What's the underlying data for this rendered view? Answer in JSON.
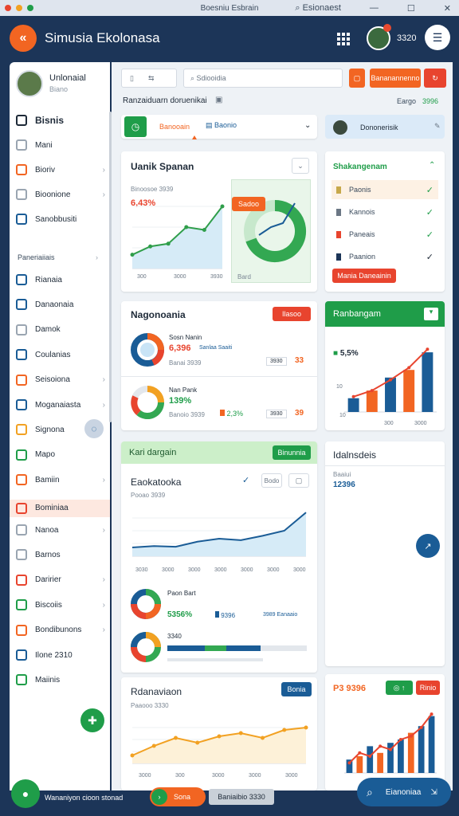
{
  "os": {
    "title": "Boesniu Esbrain",
    "controls": [
      "Esionaest",
      "—",
      "☐",
      "✕"
    ]
  },
  "app": {
    "title": "Simusia Ekolonasa",
    "logo": "«",
    "header_count": "3320"
  },
  "profile": {
    "name": "Unlonaial",
    "sub": "Biano"
  },
  "sidebar": {
    "top_items": [
      {
        "label": "Bisnis",
        "icon": "sliders-icon"
      },
      {
        "label": "Mani",
        "icon": "clock-icon"
      },
      {
        "label": "Bioriv",
        "icon": "folder-icon"
      },
      {
        "label": "Bioonione",
        "icon": "stack-icon"
      },
      {
        "label": "Sanobbusiti",
        "icon": "refresh-icon"
      }
    ],
    "section_label": "Paneriaiiais",
    "items": [
      {
        "label": "Rianaia",
        "color": "#1a5c96"
      },
      {
        "label": "Danaonaia",
        "color": "#1a5c96"
      },
      {
        "label": "Damok",
        "color": "#9aa5b1"
      },
      {
        "label": "Coulanias",
        "color": "#1a5c96"
      },
      {
        "label": "Seisoiona",
        "color": "#f26522"
      },
      {
        "label": "Moganaiasta",
        "color": "#1a5c96"
      },
      {
        "label": "Signona",
        "color": "#f2a122"
      },
      {
        "label": "Mapo",
        "color": "#1f9d49"
      },
      {
        "label": "Bamiin",
        "color": "#f26522"
      },
      {
        "label": "Bominiaa",
        "color": "#e8442e"
      },
      {
        "label": "Nanoa",
        "color": "#9aa5b1"
      },
      {
        "label": "Barnos",
        "color": "#9aa5b1"
      },
      {
        "label": "Daririer",
        "color": "#e8442e"
      },
      {
        "label": "Biscoiis",
        "color": "#1f9d49"
      },
      {
        "label": "Bondibunons",
        "color": "#f26522"
      },
      {
        "label": "Ilone 2310",
        "color": "#1a5c96"
      },
      {
        "label": "Maiinis",
        "color": "#1f9d49"
      }
    ]
  },
  "toolbar": {
    "search_placeholder": "Sdiooidia",
    "btn1": "▢",
    "btn2": "Bananannenno",
    "btn3": "↻",
    "breadcrumb": "Ranzaiduarn doruenikai",
    "right1": "Eargo",
    "right2": "3996"
  },
  "tabs": {
    "t1": "Banooain",
    "t2": "Baonio",
    "profile_tab": "Dononerisik"
  },
  "card1": {
    "title": "Uanik Spanan",
    "subtitle": "Binoosoe 3939",
    "stat": "6,43%",
    "badge": "Sadoo",
    "ticks": [
      "300",
      "3000",
      "3930"
    ],
    "gauge_label": "Bard"
  },
  "card2": {
    "title": "Shakangenam",
    "rows": [
      {
        "label": "Paonis",
        "color": "#c7a84a"
      },
      {
        "label": "Kannois",
        "color": "#6b7785"
      },
      {
        "label": "Paneais",
        "color": "#e8442e"
      },
      {
        "label": "Paanion",
        "color": "#1c3558"
      }
    ],
    "button": "Mania Daneainin"
  },
  "card3": {
    "title": "Nagonoania",
    "button": "Ilasoo",
    "row1": {
      "label": "Sosn Nanin",
      "stat": "6,396",
      "extra": "Sanlaa Saaiti",
      "sub": "Banai 3939",
      "right": "3930",
      "right2": "33"
    },
    "row2": {
      "label": "Nan Pank",
      "stat": "139%",
      "sub": "Banoio 3939",
      "pct": "2,3%",
      "right": "3930",
      "right2": "39"
    }
  },
  "card4": {
    "title": "Ranbangam",
    "stat": "5,5%",
    "ticks": [
      "10",
      "10",
      "300",
      "3000"
    ]
  },
  "card5": {
    "title": "Kari dargain",
    "button": "Binunnia",
    "subtitle": "Eaokatooka",
    "sub2": "Pooao 3939",
    "filter": "Bodo",
    "ticks": [
      "3030",
      "3000",
      "3000",
      "3000",
      "3000",
      "3000",
      "3000"
    ],
    "row1": {
      "label": "Paon Bart",
      "stat": "5356%",
      "mid": "9396",
      "right": "3989 Eanaaio"
    },
    "row2": {
      "label": "3340"
    }
  },
  "card6": {
    "title": "Idalnsdeis",
    "sub": "Baaiui",
    "stat": "12396"
  },
  "card7": {
    "title": "Rdanaviaon",
    "sub": "Paaooo 3330",
    "button": "Bonia",
    "ticks": [
      "3000",
      "300",
      "3000",
      "3000",
      "3000"
    ]
  },
  "card8": {
    "stat": "P3 9396",
    "btn": "Rinio"
  },
  "bottom": {
    "chip": "Wananiyon cioon stonad",
    "btn1": "Sona",
    "btn2": "Baniaibio 3330",
    "assist": "Eianoniaa"
  },
  "chart_data": [
    {
      "type": "area",
      "title": "Uanik Spanan",
      "x": [
        "300",
        "3000",
        "3930"
      ],
      "values": [
        10,
        16,
        18,
        30,
        28,
        45
      ],
      "ylim": [
        0,
        60
      ]
    },
    {
      "type": "bar",
      "title": "Ranbangam",
      "values": [
        18,
        28,
        45,
        55,
        78
      ],
      "line": [
        20,
        28,
        42,
        58,
        82
      ],
      "colors": [
        "#1a5c96",
        "#f26522",
        "#1a5c96",
        "#f26522",
        "#1a5c96"
      ],
      "ylim": [
        0,
        100
      ]
    },
    {
      "type": "area",
      "title": "Eaokatooka",
      "values": [
        12,
        14,
        13,
        20,
        24,
        22,
        28,
        35,
        60
      ],
      "ylim": [
        0,
        70
      ]
    },
    {
      "type": "area",
      "title": "Rdanaviaon",
      "values": [
        10,
        22,
        32,
        26,
        34,
        38,
        32,
        42,
        45
      ],
      "ylim": [
        0,
        60
      ]
    },
    {
      "type": "bar",
      "title": "P3 9396",
      "values": [
        20,
        25,
        40,
        30,
        45,
        50,
        60,
        70,
        85
      ],
      "line": [
        15,
        30,
        25,
        40,
        35,
        50,
        55,
        68,
        88
      ],
      "colors": [
        "#1a5c96",
        "#f26522",
        "#1a5c96",
        "#f26522",
        "#1a5c96",
        "#1a5c96",
        "#f26522",
        "#1a5c96",
        "#1a5c96"
      ],
      "ylim": [
        0,
        100
      ]
    }
  ]
}
